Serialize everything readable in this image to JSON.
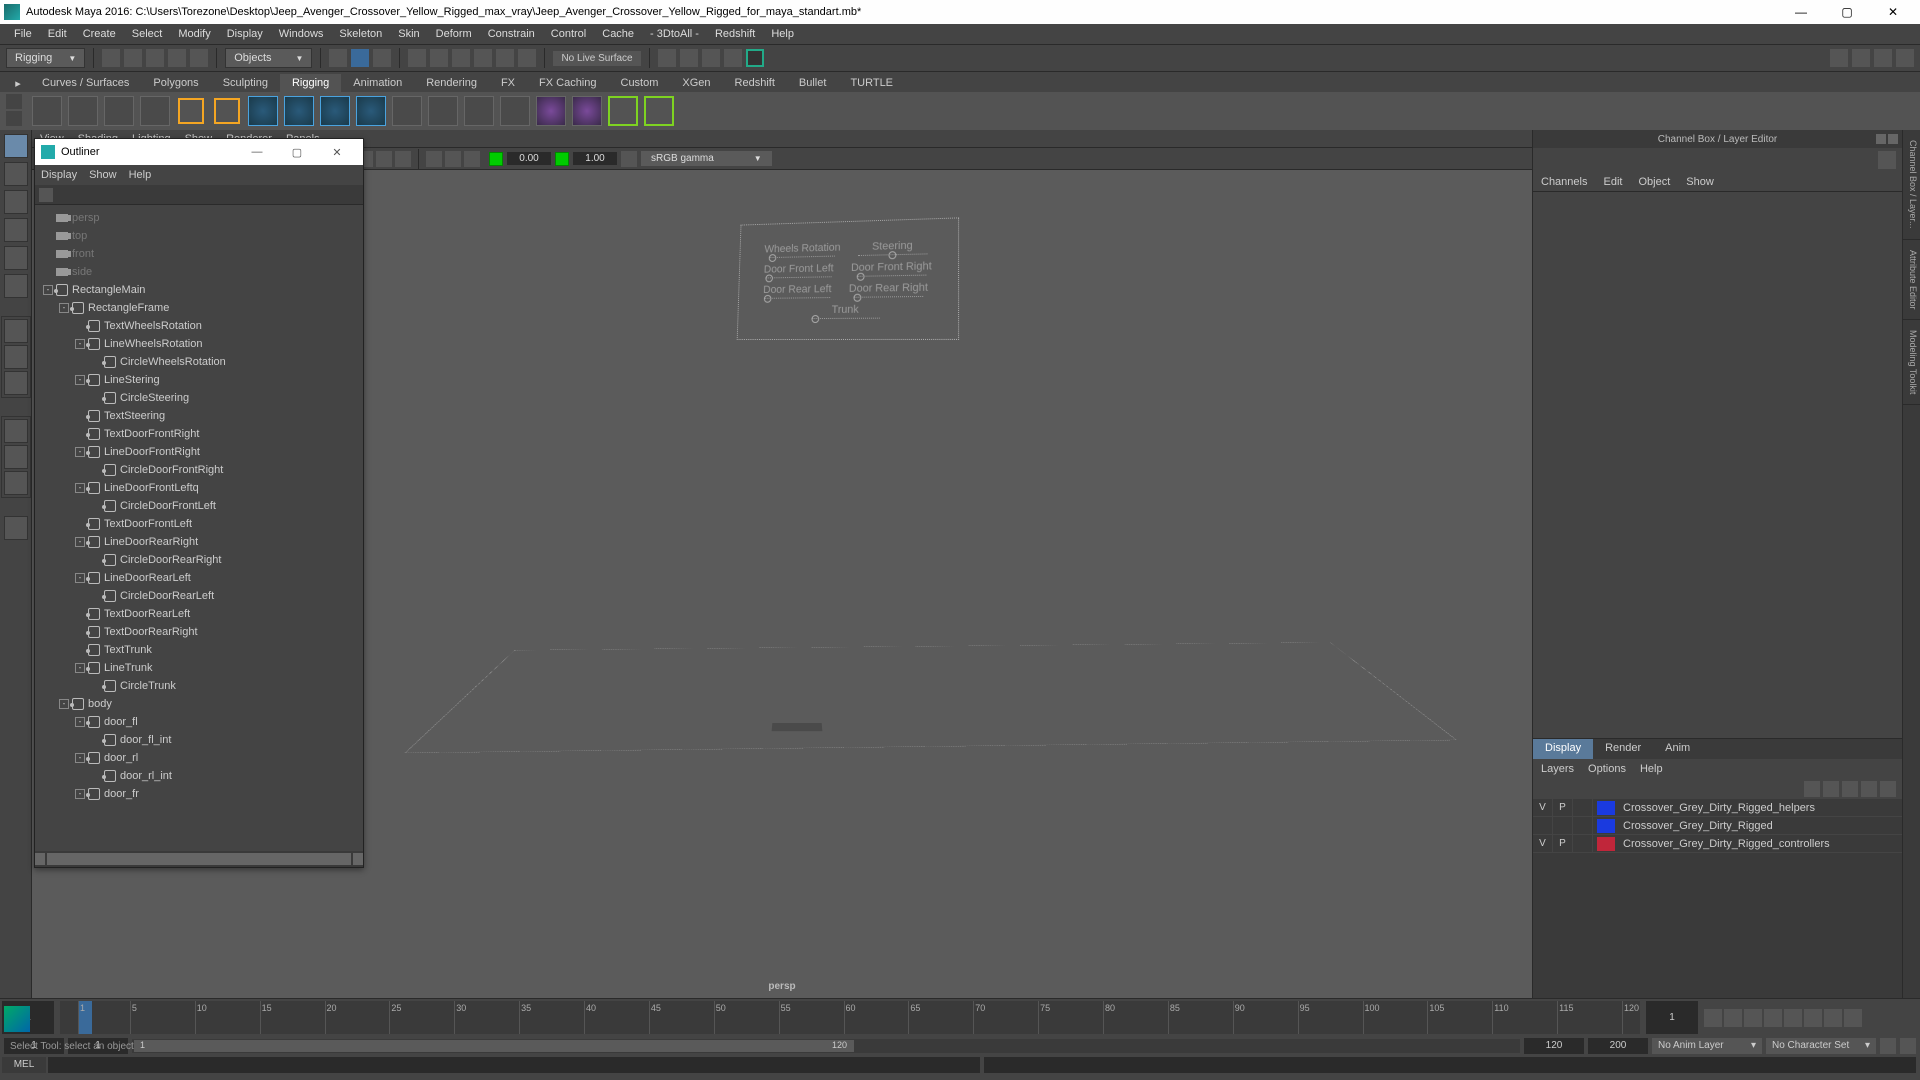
{
  "app": {
    "title": "Autodesk Maya 2016: C:\\Users\\Torezone\\Desktop\\Jeep_Avenger_Crossover_Yellow_Rigged_max_vray\\Jeep_Avenger_Crossover_Yellow_Rigged_for_maya_standart.mb*",
    "menus": [
      "File",
      "Edit",
      "Create",
      "Select",
      "Modify",
      "Display",
      "Windows",
      "Skeleton",
      "Skin",
      "Deform",
      "Constrain",
      "Control",
      "Cache",
      "- 3DtoAll -",
      "Redshift",
      "Help"
    ],
    "module": "Rigging",
    "selFilter": "Objects",
    "liveSurface": "No Live Surface"
  },
  "shelf": {
    "tabs": [
      "Curves / Surfaces",
      "Polygons",
      "Sculpting",
      "Rigging",
      "Animation",
      "Rendering",
      "FX",
      "FX Caching",
      "Custom",
      "XGen",
      "Redshift",
      "Bullet",
      "TURTLE"
    ],
    "active": "Rigging"
  },
  "viewport": {
    "menus": [
      "View",
      "Shading",
      "Lighting",
      "Show",
      "Renderer",
      "Panels"
    ],
    "gamma_a": "0.00",
    "gamma_b": "1.00",
    "gamma_mode": "sRGB gamma",
    "label": "persp",
    "controls": {
      "wheels": "Wheels Rotation",
      "steering": "Steering",
      "dfl": "Door Front Left",
      "dfr": "Door Front Right",
      "drl": "Door Rear Left",
      "drr": "Door Rear Right",
      "trunk": "Trunk"
    }
  },
  "outliner": {
    "title": "Outliner",
    "menus": [
      "Display",
      "Show",
      "Help"
    ],
    "tree": [
      {
        "d": 0,
        "t": "cam",
        "n": "persp",
        "dim": true
      },
      {
        "d": 0,
        "t": "cam",
        "n": "top",
        "dim": true
      },
      {
        "d": 0,
        "t": "cam",
        "n": "front",
        "dim": true
      },
      {
        "d": 0,
        "t": "cam",
        "n": "side",
        "dim": true
      },
      {
        "d": 0,
        "t": "grp",
        "n": "RectangleMain",
        "exp": "-"
      },
      {
        "d": 1,
        "t": "grp",
        "n": "RectangleFrame",
        "exp": "-"
      },
      {
        "d": 2,
        "t": "nurb",
        "n": "TextWheelsRotation"
      },
      {
        "d": 2,
        "t": "grp",
        "n": "LineWheelsRotation",
        "exp": "-"
      },
      {
        "d": 3,
        "t": "nurb",
        "n": "CircleWheelsRotation"
      },
      {
        "d": 2,
        "t": "grp",
        "n": "LineStering",
        "exp": "-"
      },
      {
        "d": 3,
        "t": "nurb",
        "n": "CircleSteering"
      },
      {
        "d": 2,
        "t": "nurb",
        "n": "TextSteering"
      },
      {
        "d": 2,
        "t": "nurb",
        "n": "TextDoorFrontRight"
      },
      {
        "d": 2,
        "t": "grp",
        "n": "LineDoorFrontRight",
        "exp": "-"
      },
      {
        "d": 3,
        "t": "nurb",
        "n": "CircleDoorFrontRight"
      },
      {
        "d": 2,
        "t": "grp",
        "n": "LineDoorFrontLeftq",
        "exp": "-"
      },
      {
        "d": 3,
        "t": "nurb",
        "n": "CircleDoorFrontLeft"
      },
      {
        "d": 2,
        "t": "nurb",
        "n": "TextDoorFrontLeft"
      },
      {
        "d": 2,
        "t": "grp",
        "n": "LineDoorRearRight",
        "exp": "-"
      },
      {
        "d": 3,
        "t": "nurb",
        "n": "CircleDoorRearRight"
      },
      {
        "d": 2,
        "t": "grp",
        "n": "LineDoorRearLeft",
        "exp": "-"
      },
      {
        "d": 3,
        "t": "nurb",
        "n": "CircleDoorRearLeft"
      },
      {
        "d": 2,
        "t": "nurb",
        "n": "TextDoorRearLeft"
      },
      {
        "d": 2,
        "t": "nurb",
        "n": "TextDoorRearRight"
      },
      {
        "d": 2,
        "t": "nurb",
        "n": "TextTrunk"
      },
      {
        "d": 2,
        "t": "grp",
        "n": "LineTrunk",
        "exp": "-"
      },
      {
        "d": 3,
        "t": "nurb",
        "n": "CircleTrunk"
      },
      {
        "d": 1,
        "t": "grp",
        "n": "body",
        "exp": "-"
      },
      {
        "d": 2,
        "t": "grp",
        "n": "door_fl",
        "exp": "-"
      },
      {
        "d": 3,
        "t": "nurb",
        "n": "door_fl_int"
      },
      {
        "d": 2,
        "t": "grp",
        "n": "door_rl",
        "exp": "-"
      },
      {
        "d": 3,
        "t": "nurb",
        "n": "door_rl_int"
      },
      {
        "d": 2,
        "t": "grp",
        "n": "door_fr",
        "exp": "-"
      }
    ]
  },
  "channelbox": {
    "title": "Channel Box / Layer Editor",
    "menus": [
      "Channels",
      "Edit",
      "Object",
      "Show"
    ],
    "layertabs": [
      "Display",
      "Render",
      "Anim"
    ],
    "layermenus": [
      "Layers",
      "Options",
      "Help"
    ],
    "layers": [
      {
        "v": "V",
        "p": "P",
        "c": "#1a3adf",
        "n": "Crossover_Grey_Dirty_Rigged_helpers"
      },
      {
        "v": "",
        "p": "",
        "c": "#1a3adf",
        "n": "Crossover_Grey_Dirty_Rigged"
      },
      {
        "v": "V",
        "p": "P",
        "c": "#c0263a",
        "n": "Crossover_Grey_Dirty_Rigged_controllers"
      }
    ]
  },
  "timeline": {
    "cur": "1",
    "startOut": "1",
    "start": "1",
    "end": "120",
    "endOut": "200",
    "frames": [
      1,
      5,
      10,
      15,
      20,
      25,
      30,
      35,
      40,
      45,
      50,
      55,
      60,
      65,
      70,
      75,
      80,
      85,
      90,
      95,
      100,
      105,
      110,
      115,
      120
    ],
    "animLayer": "No Anim Layer",
    "charSet": "No Character Set"
  },
  "cmd": {
    "lang": "MEL"
  },
  "help": "Select Tool: select an object"
}
